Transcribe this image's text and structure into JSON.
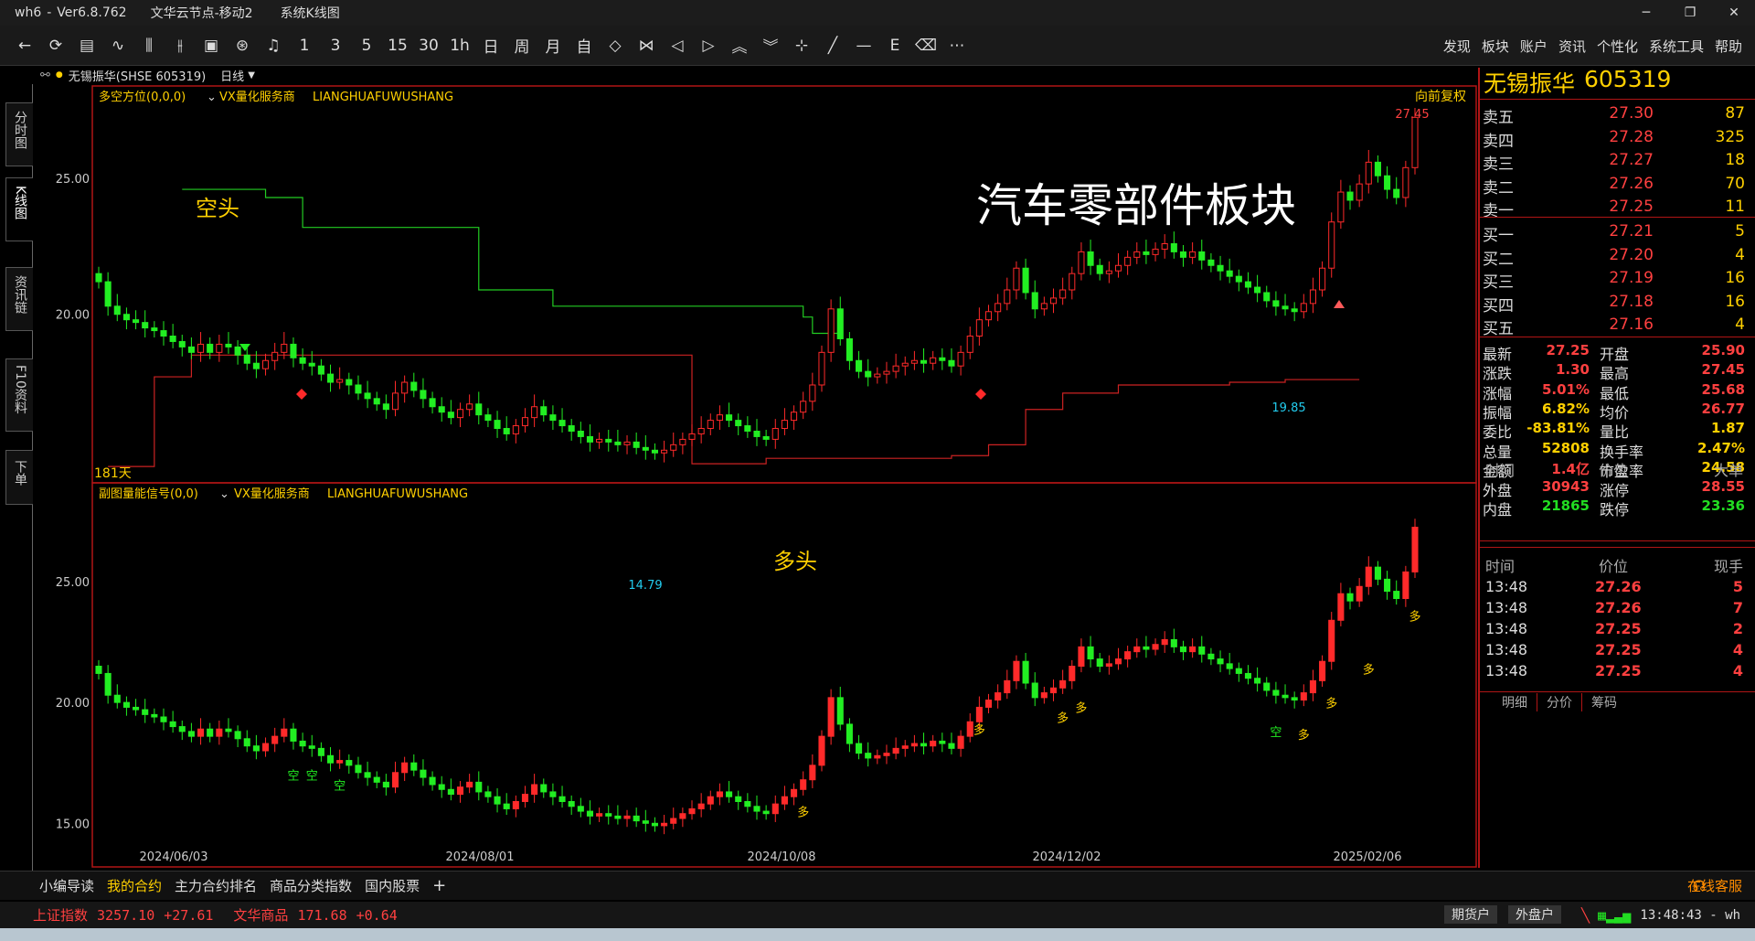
{
  "window": {
    "app": "wh6",
    "version": "Ver6.8.762",
    "node": "文华云节点-移动2",
    "view": "系统K线图"
  },
  "toolbar": {
    "icons": [
      "back-icon",
      "refresh-icon",
      "quote-list-icon",
      "timeshare-icon",
      "candle-icon",
      "bar-icon",
      "kline-icon",
      "sync-icon",
      "alert-icon"
    ],
    "periods": [
      "1",
      "3",
      "5",
      "15",
      "30",
      "1h",
      "日",
      "周",
      "月",
      "自"
    ],
    "tools": [
      "zoom-out-icon",
      "zoom-in-icon",
      "scroll-left-icon",
      "scroll-right-icon",
      "scroll-up-icon",
      "scroll-down-icon",
      "crosshair-icon",
      "draw-line-icon",
      "hline-icon",
      "formula-icon",
      "eraser-icon",
      "more-icon"
    ],
    "menus": [
      "发现",
      "板块",
      "账户",
      "资讯",
      "个性化",
      "系统工具",
      "帮助"
    ]
  },
  "info": {
    "name_code": "无锡振华(SHSE 605319)",
    "period": "日线"
  },
  "lefttabs": [
    "分时图",
    "K线图",
    "资讯链",
    "F10资料",
    "下单"
  ],
  "chart_data": [
    {
      "type": "candlestick",
      "panel": "main",
      "indicator": "多空方位(0,0,0)",
      "vendor": "VX量化服务商",
      "vendor2": "LIANGHUAFUWUSHANG",
      "adjust": "向前复权",
      "ylim": [
        14,
        27.8
      ],
      "y_ticks": [
        "25.00",
        "20.00"
      ],
      "x_labels": [
        "2024/06/03",
        "2024/08/01",
        "2024/10/08",
        "2024/12/02",
        "2025/02/06"
      ],
      "annotations": {
        "title": "汽车零部件板块",
        "bear": "空头",
        "bull": "多头",
        "high": "27.45",
        "low1": "14.79",
        "low2": "19.85",
        "days": "181天"
      },
      "close": [
        21.2,
        20.3,
        20,
        19.8,
        19.7,
        19.5,
        19.4,
        19.2,
        19,
        18.8,
        18.6,
        18.9,
        18.6,
        18.9,
        18.8,
        18.5,
        18.2,
        18,
        18.3,
        18.6,
        18.9,
        18.4,
        18.2,
        18.1,
        17.8,
        17.5,
        17.6,
        17.4,
        17.1,
        16.9,
        16.7,
        16.5,
        17.1,
        17.5,
        17.2,
        16.9,
        16.6,
        16.4,
        16.2,
        16.5,
        16.7,
        16.3,
        16.1,
        15.8,
        15.6,
        15.9,
        16.2,
        16.6,
        16.3,
        16.1,
        15.9,
        15.7,
        15.5,
        15.3,
        15.4,
        15.3,
        15.2,
        15.3,
        15.1,
        15,
        14.9,
        15,
        15.2,
        15.4,
        15.6,
        15.8,
        16.1,
        16.3,
        16.1,
        15.9,
        15.7,
        15.5,
        15.4,
        15.8,
        16.1,
        16.4,
        16.8,
        17.4,
        18.6,
        20.2,
        19.1,
        18.3,
        17.9,
        17.7,
        17.8,
        17.9,
        18.1,
        18.2,
        18.3,
        18.2,
        18.4,
        18.3,
        18.1,
        18.6,
        19.2,
        19.8,
        20.1,
        20.4,
        20.9,
        21.7,
        20.8,
        20.2,
        20.4,
        20.6,
        20.9,
        21.5,
        22.3,
        21.8,
        21.5,
        21.6,
        21.8,
        22.1,
        22.3,
        22.2,
        22.4,
        22.6,
        22.3,
        22.1,
        22.3,
        22,
        21.8,
        21.6,
        21.4,
        21.2,
        21,
        20.8,
        20.5,
        20.3,
        20.2,
        20.1,
        20.4,
        20.9,
        21.7,
        23.4,
        24.5,
        24.2,
        24.8,
        25.6,
        25.1,
        24.6,
        24.3,
        25.4,
        27.25
      ],
      "bear_line": {
        "dates": [
          9,
          18,
          22,
          30,
          37,
          41,
          49,
          76,
          77
        ],
        "levels": [
          24.6,
          24.3,
          23.2,
          23.2,
          23.2,
          20.9,
          20.3,
          19.9,
          19.3
        ]
      },
      "bull_line": {
        "dates": [
          14,
          20,
          28,
          36,
          44,
          52,
          58,
          64,
          68
        ],
        "levels": [
          17.7,
          17.7,
          17.7,
          14.3,
          14.3,
          14.3,
          14.4,
          14.6,
          15.2
        ]
      }
    },
    {
      "type": "candlestick",
      "panel": "sub",
      "indicator": "副图量能信号(0,0)",
      "vendor": "VX量化服务商",
      "vendor2": "LIANGHUAFUWUSHANG",
      "y_ticks": [
        "25.00",
        "20.00",
        "15.00"
      ],
      "signals": {
        "bear": "空",
        "bull": "多"
      }
    }
  ],
  "quote": {
    "name": "无锡振华",
    "code": "605319",
    "asks": [
      {
        "l": "卖五",
        "p": "27.30",
        "v": "87"
      },
      {
        "l": "卖四",
        "p": "27.28",
        "v": "325"
      },
      {
        "l": "卖三",
        "p": "27.27",
        "v": "18"
      },
      {
        "l": "卖二",
        "p": "27.26",
        "v": "70"
      },
      {
        "l": "卖一",
        "p": "27.25",
        "v": "11"
      }
    ],
    "bids": [
      {
        "l": "买一",
        "p": "27.21",
        "v": "5"
      },
      {
        "l": "买二",
        "p": "27.20",
        "v": "4"
      },
      {
        "l": "买三",
        "p": "27.19",
        "v": "16"
      },
      {
        "l": "买四",
        "p": "27.18",
        "v": "16"
      },
      {
        "l": "买五",
        "p": "27.16",
        "v": "4"
      }
    ],
    "stats": [
      {
        "a": "最新",
        "av": "27.25",
        "ac": "#ff4040",
        "b": "开盘",
        "bv": "25.90",
        "bc": "#ff4040"
      },
      {
        "a": "涨跌",
        "av": "1.30",
        "ac": "#ff4040",
        "b": "最高",
        "bv": "27.45",
        "bc": "#ff4040"
      },
      {
        "a": "涨幅",
        "av": "5.01%",
        "ac": "#ff4040",
        "b": "最低",
        "bv": "25.68",
        "bc": "#ff4040"
      },
      {
        "a": "振幅",
        "av": "6.82%",
        "ac": "#ffd000",
        "b": "均价",
        "bv": "26.77",
        "bc": "#ff4040"
      },
      {
        "a": "委比",
        "av": "-83.81%",
        "ac": "#ffd000",
        "b": "量比",
        "bv": "1.87",
        "bc": "#ffd000"
      },
      {
        "a": "总量",
        "av": "52808",
        "ac": "#ffd000",
        "b": "换手率",
        "bv": "2.47%",
        "bc": "#ffd000"
      },
      {
        "a": "金额",
        "av": "1.4亿",
        "ac": "#ff4040",
        "b": "市盈率",
        "bv": "24.58",
        "bc": "#ffd000"
      },
      {
        "a": "外盘",
        "av": "30943",
        "ac": "#ff4040",
        "b": "涨停",
        "bv": "28.55",
        "bc": "#ff4040"
      },
      {
        "a": "内盘",
        "av": "21865",
        "ac": "#22dd22",
        "b": "跌停",
        "bv": "23.36",
        "bc": "#22dd22"
      }
    ],
    "h1": [
      "时间",
      "价位",
      "大单"
    ],
    "h2": [
      "时间",
      "价位",
      "现手"
    ],
    "ticks": [
      {
        "t": "13:48",
        "p": "27.26",
        "v": "5"
      },
      {
        "t": "13:48",
        "p": "27.26",
        "v": "7"
      },
      {
        "t": "13:48",
        "p": "27.25",
        "v": "2"
      },
      {
        "t": "13:48",
        "p": "27.25",
        "v": "4"
      },
      {
        "t": "13:48",
        "p": "27.25",
        "v": "4"
      }
    ],
    "tabs": [
      "明细",
      "分价",
      "筹码"
    ]
  },
  "bottom_tabs": [
    "小编导读",
    "我的合约",
    "主力合约排名",
    "商品分类指数",
    "国内股票",
    "+"
  ],
  "service": "在线客服",
  "status": {
    "i1": "上证指数",
    "i1v": "3257.10",
    "i1c": "+27.61",
    "i2": "文华商品",
    "i2v": "171.68",
    "i2c": "+0.64",
    "b1": "期货户",
    "b2": "外盘户",
    "time": "13:48:43 - wh"
  },
  "colors": {
    "up": "#ff2a2a",
    "down": "#22ee22",
    "frame": "#b01515",
    "yellow": "#ffd000",
    "cyan": "#22ccee"
  }
}
